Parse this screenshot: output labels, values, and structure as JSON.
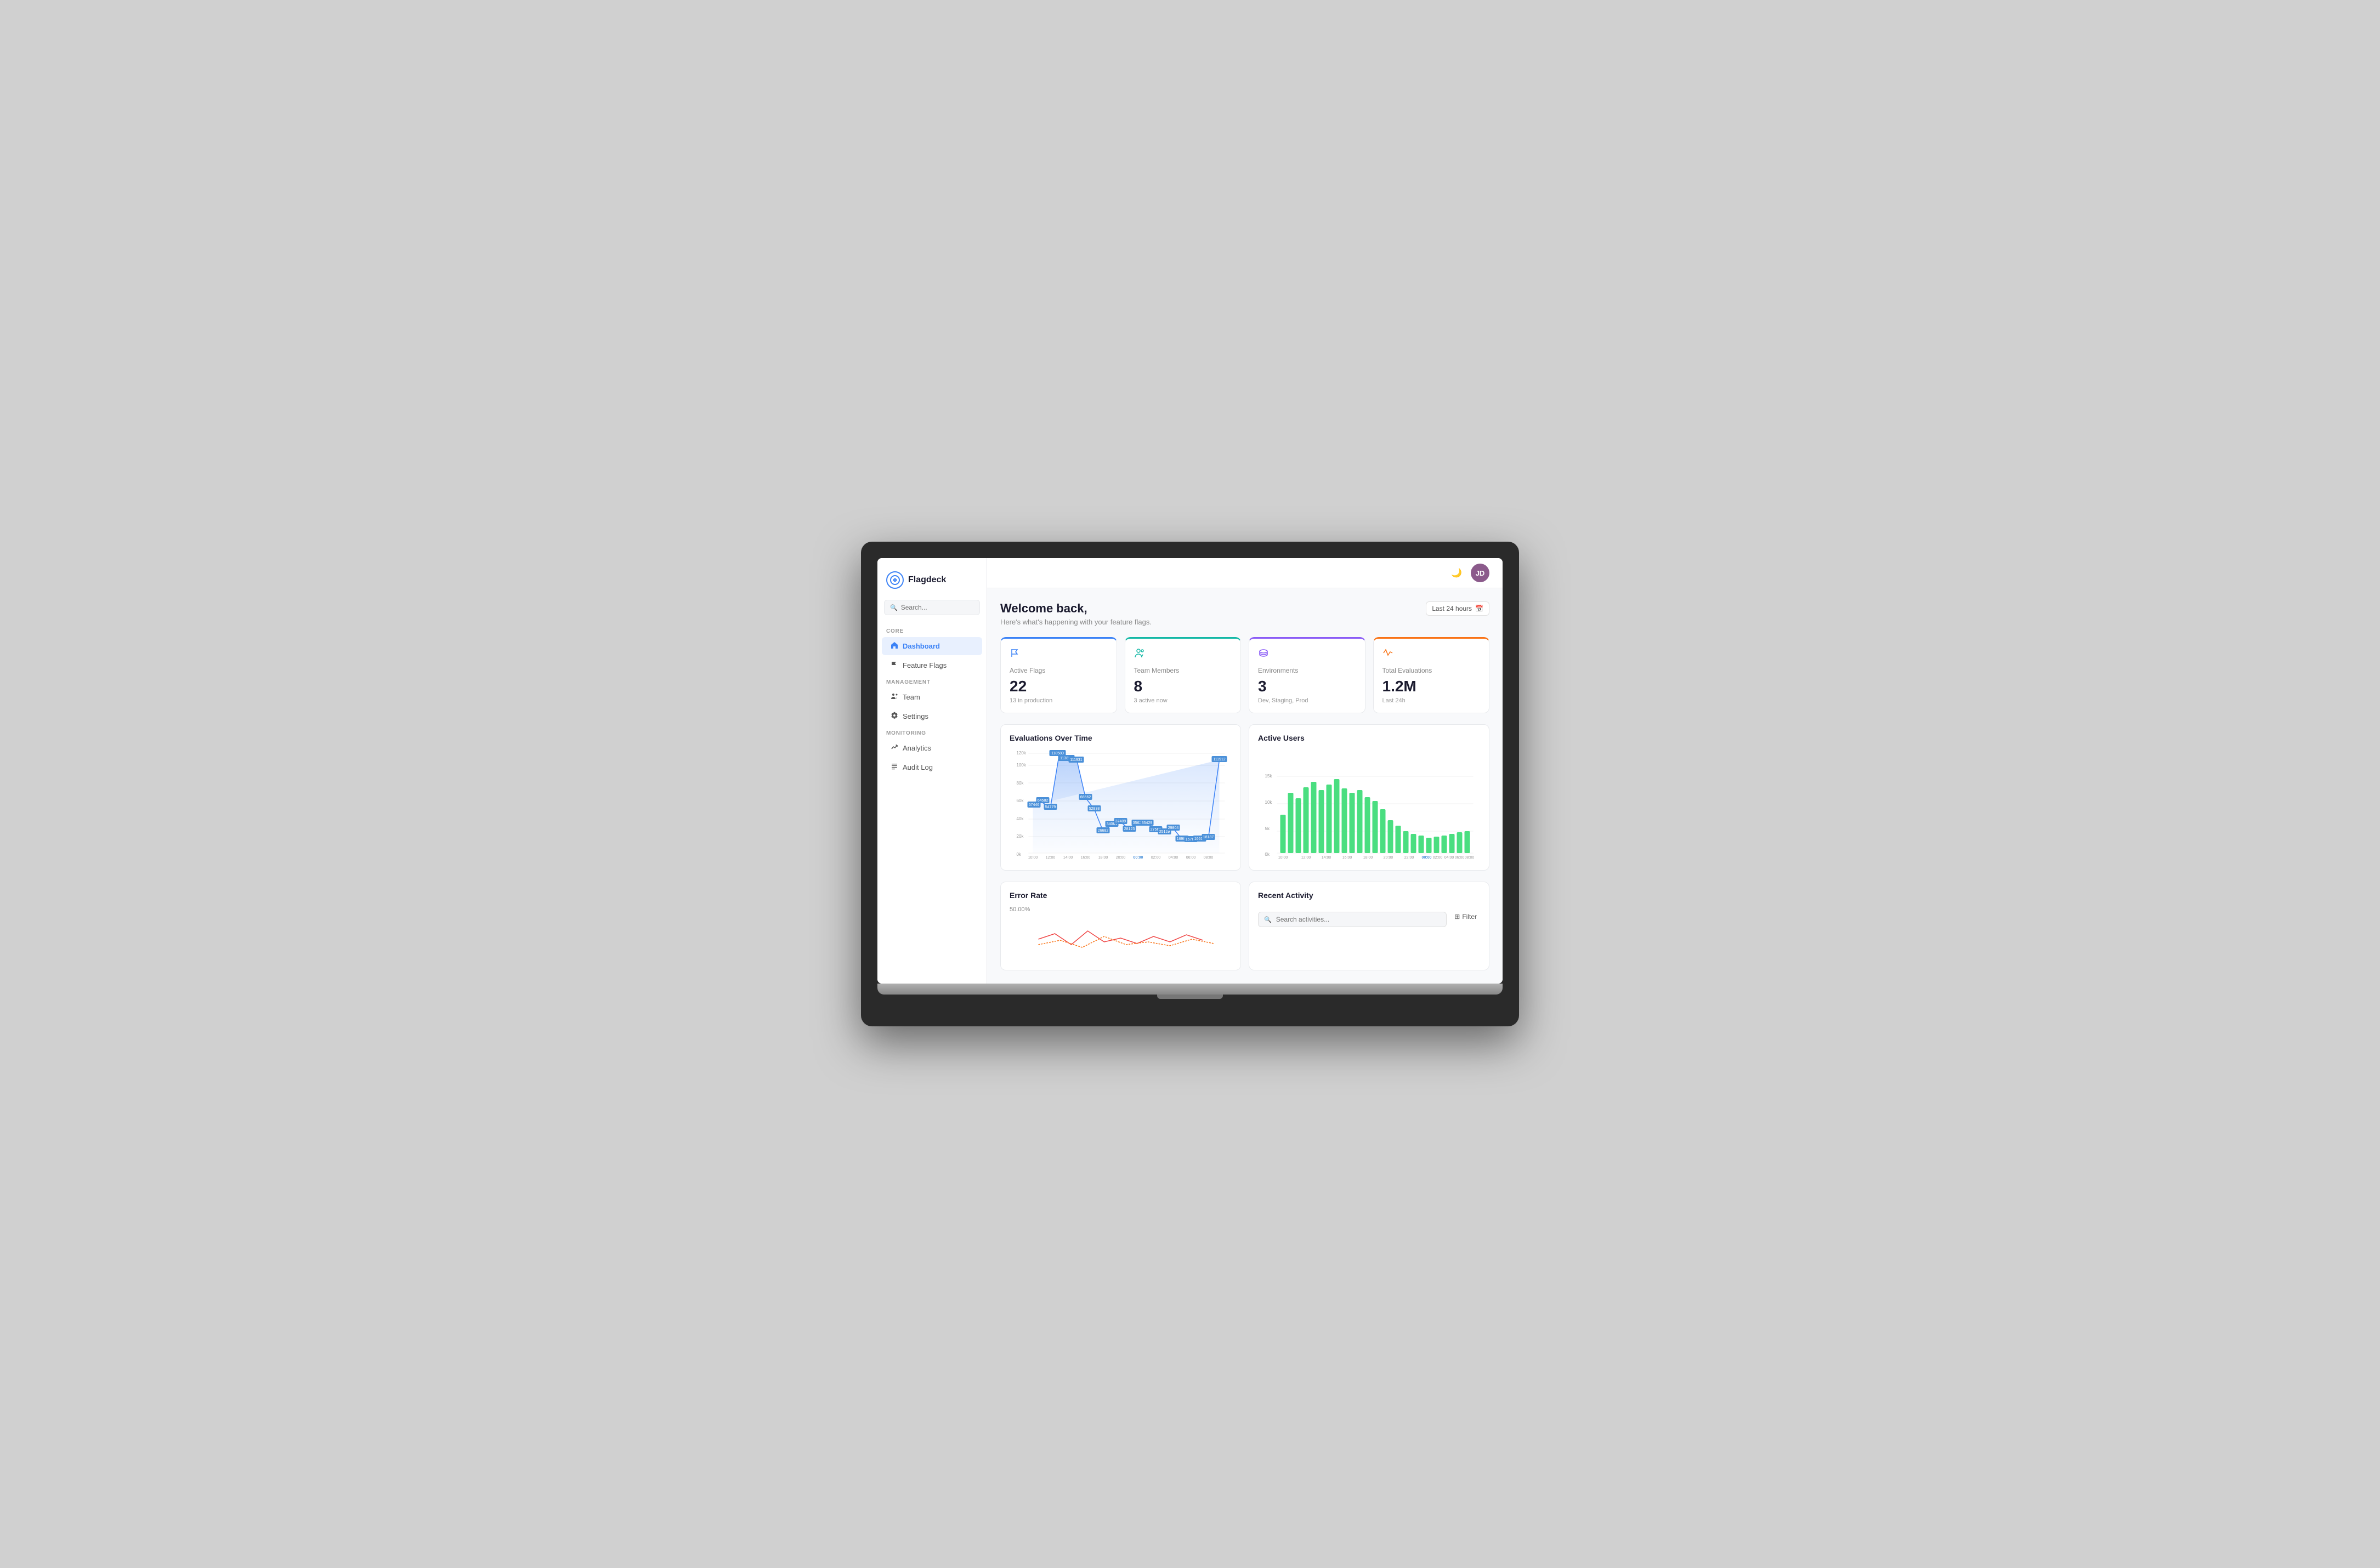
{
  "app": {
    "name": "Flagdeck",
    "user_initials": "JD"
  },
  "sidebar": {
    "search_placeholder": "Search...",
    "sections": [
      {
        "label": "CORE",
        "items": [
          {
            "id": "dashboard",
            "label": "Dashboard",
            "icon": "🏠",
            "active": true
          },
          {
            "id": "feature-flags",
            "label": "Feature Flags",
            "icon": "⚑",
            "active": false
          }
        ]
      },
      {
        "label": "MANAGEMENT",
        "items": [
          {
            "id": "team",
            "label": "Team",
            "icon": "👥",
            "active": false
          },
          {
            "id": "settings",
            "label": "Settings",
            "icon": "⚙",
            "active": false
          }
        ]
      },
      {
        "label": "MONITORING",
        "items": [
          {
            "id": "analytics",
            "label": "Analytics",
            "icon": "📈",
            "active": false
          },
          {
            "id": "audit-log",
            "label": "Audit Log",
            "icon": "☰",
            "active": false
          }
        ]
      }
    ]
  },
  "header": {
    "time_filter": "Last 24 hours"
  },
  "page": {
    "title": "Welcome back,",
    "subtitle": "Here's what's happening with your feature flags."
  },
  "stat_cards": [
    {
      "id": "active-flags",
      "label": "Active Flags",
      "value": "22",
      "sub": "13 in production",
      "icon": "⚑",
      "color": "blue"
    },
    {
      "id": "team-members",
      "label": "Team Members",
      "value": "8",
      "sub": "3 active now",
      "icon": "👥",
      "color": "teal"
    },
    {
      "id": "environments",
      "label": "Environments",
      "value": "3",
      "sub": "Dev, Staging, Prod",
      "icon": "🗂",
      "color": "purple"
    },
    {
      "id": "total-evaluations",
      "label": "Total Evaluations",
      "value": "1.2M",
      "sub": "Last 24h",
      "icon": "〜",
      "color": "orange"
    }
  ],
  "evaluations_chart": {
    "title": "Evaluations Over Time",
    "x_labels": [
      "10:00",
      "12:00",
      "14:00",
      "16:00",
      "18:00",
      "20:00",
      "00:00",
      "02:00",
      "04:00",
      "06:00",
      "08:00"
    ],
    "y_labels": [
      "0k",
      "20k",
      "40k",
      "60k",
      "80k",
      "100k",
      "120k"
    ],
    "data_points": [
      {
        "label": "57446",
        "x": 0
      },
      {
        "label": "64582",
        "x": 1
      },
      {
        "label": "54779",
        "x": 2
      },
      {
        "label": "118580",
        "x": 3
      },
      {
        "label": "113898",
        "x": 4
      },
      {
        "label": "111931",
        "x": 5
      },
      {
        "label": "66662",
        "x": 6
      },
      {
        "label": "52838",
        "x": 7
      },
      {
        "label": "26682",
        "x": 8
      },
      {
        "label": "34081",
        "x": 9
      },
      {
        "label": "37409",
        "x": 10
      },
      {
        "label": "28123",
        "x": 11
      },
      {
        "label": "35625",
        "x": 12
      },
      {
        "label": "35429",
        "x": 13
      },
      {
        "label": "27568",
        "x": 14
      },
      {
        "label": "25129",
        "x": 15
      },
      {
        "label": "29804",
        "x": 16
      },
      {
        "label": "16982",
        "x": 17
      },
      {
        "label": "15761",
        "x": 18
      },
      {
        "label": "16659",
        "x": 19
      },
      {
        "label": "18187",
        "x": 20
      },
      {
        "label": "111912",
        "x": 21
      }
    ]
  },
  "active_users_chart": {
    "title": "Active Users",
    "x_labels": [
      "10:00",
      "12:00",
      "14:00",
      "16:00",
      "18:00",
      "20:00",
      "22:00",
      "00:00",
      "02:00",
      "04:00",
      "06:00",
      "08:00"
    ],
    "y_labels": [
      "0k",
      "5k",
      "10k",
      "15k"
    ]
  },
  "error_rate": {
    "title": "Error Rate",
    "value": "50.00%"
  },
  "recent_activity": {
    "title": "Recent Activity",
    "search_placeholder": "Search activities...",
    "filter_label": "Filter"
  }
}
